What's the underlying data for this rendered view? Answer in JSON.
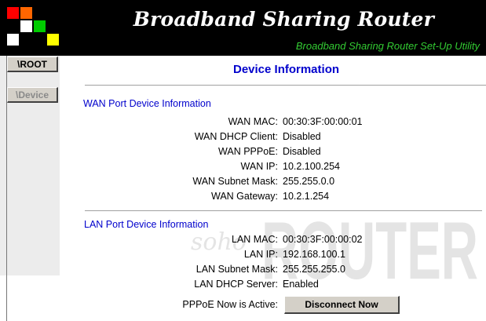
{
  "header": {
    "title": "Broadband Sharing Router",
    "subtitle": "Broadband Sharing Router Set-Up Utility",
    "logo_colors": [
      "#ff0000",
      "#ff6600",
      "#ffffff",
      "#00cc00",
      "#ffff00"
    ]
  },
  "sidebar": {
    "items": [
      {
        "label": "\\ROOT"
      },
      {
        "label": "\\Device"
      }
    ]
  },
  "main": {
    "page_title": "Device Information",
    "wan": {
      "title": "WAN Port Device Information",
      "rows": [
        {
          "label": "WAN MAC:",
          "value": "00:30:3F:00:00:01"
        },
        {
          "label": "WAN DHCP Client:",
          "value": "Disabled"
        },
        {
          "label": "WAN PPPoE:",
          "value": "Disabled"
        },
        {
          "label": "WAN IP:",
          "value": "10.2.100.254"
        },
        {
          "label": "WAN Subnet Mask:",
          "value": "255.255.0.0"
        },
        {
          "label": "WAN Gateway:",
          "value": "10.2.1.254"
        }
      ]
    },
    "lan": {
      "title": "LAN Port Device Information",
      "rows": [
        {
          "label": "LAN MAC:",
          "value": "00:30:3F:00:00:02"
        },
        {
          "label": "LAN IP:",
          "value": "192.168.100.1"
        },
        {
          "label": "LAN Subnet Mask:",
          "value": "255.255.255.0"
        },
        {
          "label": "LAN DHCP Server:",
          "value": "Enabled"
        }
      ]
    },
    "pppoe": {
      "label": "PPPoE Now is Active:",
      "button_label": "Disconnect Now"
    },
    "watermark": {
      "brand_small": "soho",
      "brand_large": "ROUTER"
    }
  },
  "colors": {
    "section_title": "#0000cc",
    "subtitle": "#33cc33",
    "header_bg": "#000000",
    "sidebar_bg": "#ececec"
  }
}
